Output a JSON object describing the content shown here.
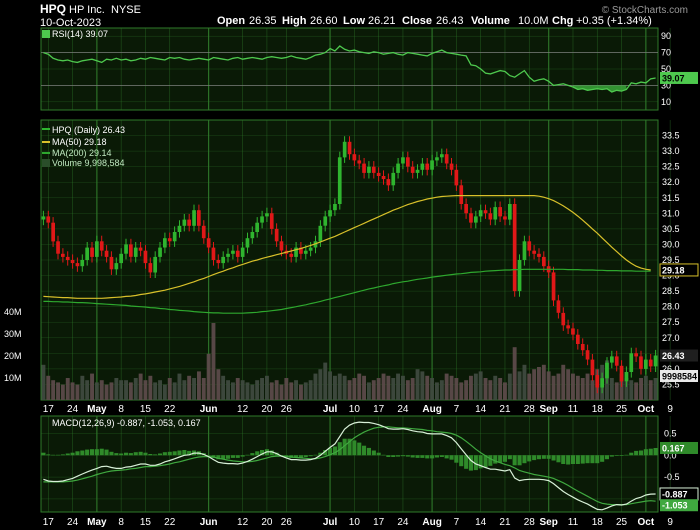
{
  "header": {
    "symbol": "HPQ",
    "company": "HP Inc.",
    "exchange": "NYSE",
    "date": "10-Oct-2023",
    "quote": {
      "open_label": "Open",
      "open": "26.35",
      "high_label": "High",
      "high": "26.60",
      "low_label": "Low",
      "low": "26.21",
      "close_label": "Close",
      "close": "26.43",
      "volume_label": "Volume",
      "volume": "10.0M",
      "chg_label": "Chg",
      "chg": "+0.35 (+1.34%)"
    },
    "watermark": "© StockCharts.com"
  },
  "colors": {
    "bg": "#000000",
    "panel": "#0a1a06",
    "grid": "#2f7a2a",
    "up": "#2fb52f",
    "down": "#e01818",
    "ma50": "#d8c02a",
    "ma200": "#2ea82e",
    "rsi": "#4ec94e",
    "macd": "#d8f0d8",
    "signal": "#3fa83f",
    "hist": "#2f8a2a",
    "volume": "#5a4f4f"
  },
  "chart_data": [
    {
      "type": "line",
      "name": "rsi",
      "legend": "RSI(14) 39.07",
      "ylim": [
        0,
        100
      ],
      "y_ticks": [
        90,
        70,
        50,
        30,
        10
      ],
      "bands": [
        30,
        70
      ],
      "last_label": "39.07",
      "values": [
        70,
        68,
        63,
        61,
        60,
        61,
        59,
        58,
        60,
        61,
        62,
        60,
        58,
        62,
        61,
        63,
        61,
        62,
        60,
        61,
        63,
        62,
        64,
        63,
        62,
        61,
        64,
        63,
        64,
        62,
        61,
        62,
        63,
        62,
        61,
        64,
        63,
        62,
        61,
        63,
        64,
        62,
        63,
        64,
        63,
        62,
        64,
        65,
        64,
        63,
        64,
        66,
        64,
        63,
        62,
        64,
        67,
        68,
        70,
        75,
        72,
        78,
        74,
        72,
        73,
        71,
        70,
        69,
        71,
        70,
        68,
        69,
        70,
        68,
        67,
        70,
        69,
        68,
        67,
        66,
        69,
        71,
        73,
        70,
        69,
        68,
        67,
        66,
        55,
        54,
        50,
        45,
        44,
        46,
        48,
        47,
        42,
        40,
        44,
        48,
        40,
        35,
        37,
        38,
        35,
        30,
        31,
        32,
        30,
        28,
        25,
        26,
        24,
        25,
        26,
        25,
        26,
        22,
        24,
        23,
        25,
        33,
        32,
        34,
        33,
        38,
        39.07
      ]
    },
    {
      "type": "candlestick",
      "name": "price",
      "legend": [
        "HPQ (Daily) 26.43",
        "MA(50) 29.18",
        "MA(200) 29.14",
        "Volume 9,998,584"
      ],
      "ylim": [
        25.0,
        34.0
      ],
      "y_ticks": [
        33.5,
        33.0,
        32.5,
        32.0,
        31.5,
        31.0,
        30.5,
        30.0,
        29.5,
        29.0,
        28.5,
        28.0,
        27.5,
        27.0,
        26.5,
        26.0,
        25.5
      ],
      "close_tag": "26.43",
      "ma_tag": "29.18",
      "volume_tag": "9998584",
      "volume_ticks": [
        "40M",
        "30M",
        "20M",
        "10M"
      ],
      "volume_ylim": [
        0,
        50
      ],
      "closes": [
        30.9,
        30.7,
        30.1,
        29.7,
        29.6,
        29.5,
        29.4,
        29.3,
        29.5,
        29.9,
        29.6,
        30.1,
        29.8,
        29.6,
        29.2,
        29.4,
        29.7,
        30.0,
        29.6,
        29.9,
        29.8,
        29.4,
        29.1,
        29.6,
        29.9,
        30.2,
        30.1,
        30.4,
        30.6,
        30.8,
        30.6,
        31.1,
        30.6,
        30.2,
        29.9,
        29.5,
        29.4,
        29.6,
        29.7,
        29.8,
        29.6,
        29.9,
        30.2,
        30.4,
        30.7,
        30.9,
        31.0,
        30.5,
        30.1,
        29.8,
        29.7,
        29.6,
        29.9,
        29.7,
        29.8,
        29.9,
        30.1,
        30.6,
        30.9,
        31.1,
        31.3,
        32.8,
        33.3,
        32.9,
        32.7,
        32.6,
        32.3,
        32.5,
        32.3,
        32.2,
        32.1,
        31.9,
        32.3,
        32.6,
        32.8,
        32.5,
        32.3,
        32.4,
        32.6,
        32.4,
        32.7,
        32.8,
        32.9,
        32.6,
        32.4,
        31.9,
        31.3,
        31.0,
        30.7,
        30.9,
        31.1,
        31.0,
        30.8,
        31.2,
        30.9,
        30.8,
        31.3,
        28.5,
        29.5,
        30.1,
        29.8,
        29.7,
        29.6,
        29.3,
        29.1,
        28.2,
        27.8,
        27.4,
        27.3,
        27.1,
        26.8,
        26.6,
        26.3,
        25.8,
        25.4,
        25.7,
        26.2,
        26.4,
        26.1,
        25.6,
        25.9,
        26.5,
        26.4,
        26.0,
        26.3,
        26.08,
        26.43
      ],
      "ma50": [
        28.33,
        28.32,
        28.31,
        28.3,
        28.29,
        28.29,
        28.28,
        28.27,
        28.27,
        28.27,
        28.27,
        28.27,
        28.27,
        28.28,
        28.29,
        28.3,
        28.31,
        28.33,
        28.34,
        28.36,
        28.39,
        28.41,
        28.44,
        28.47,
        28.5,
        28.53,
        28.57,
        28.61,
        28.65,
        28.7,
        28.75,
        28.8,
        28.86,
        28.91,
        28.97,
        29.03,
        29.09,
        29.14,
        29.2,
        29.25,
        29.31,
        29.36,
        29.41,
        29.46,
        29.5,
        29.55,
        29.59,
        29.63,
        29.67,
        29.71,
        29.75,
        29.79,
        29.83,
        29.87,
        29.92,
        29.97,
        30.02,
        30.08,
        30.14,
        30.2,
        30.26,
        30.33,
        30.4,
        30.47,
        30.54,
        30.61,
        30.68,
        30.75,
        30.82,
        30.89,
        30.96,
        31.03,
        31.1,
        31.16,
        31.22,
        31.28,
        31.33,
        31.38,
        31.42,
        31.46,
        31.49,
        31.52,
        31.54,
        31.55,
        31.56,
        31.57,
        31.57,
        31.57,
        31.57,
        31.57,
        31.57,
        31.57,
        31.57,
        31.57,
        31.57,
        31.57,
        31.57,
        31.57,
        31.57,
        31.57,
        31.57,
        31.57,
        31.55,
        31.52,
        31.47,
        31.41,
        31.33,
        31.24,
        31.14,
        31.03,
        30.91,
        30.78,
        30.64,
        30.5,
        30.36,
        30.21,
        30.06,
        29.91,
        29.77,
        29.63,
        29.5,
        29.39,
        29.3,
        29.24,
        29.2,
        29.18
      ],
      "ma200": [
        28.17,
        28.17,
        28.16,
        28.16,
        28.15,
        28.15,
        28.14,
        28.13,
        28.13,
        28.12,
        28.11,
        28.1,
        28.09,
        28.08,
        28.07,
        28.06,
        28.05,
        28.04,
        28.02,
        28.01,
        28.0,
        27.99,
        27.97,
        27.96,
        27.94,
        27.93,
        27.91,
        27.9,
        27.88,
        27.87,
        27.86,
        27.84,
        27.83,
        27.82,
        27.81,
        27.8,
        27.8,
        27.79,
        27.79,
        27.79,
        27.79,
        27.79,
        27.8,
        27.81,
        27.82,
        27.84,
        27.85,
        27.87,
        27.89,
        27.91,
        27.94,
        27.97,
        28.0,
        28.03,
        28.06,
        28.1,
        28.13,
        28.17,
        28.21,
        28.25,
        28.29,
        28.33,
        28.37,
        28.41,
        28.45,
        28.49,
        28.53,
        28.57,
        28.6,
        28.64,
        28.67,
        28.7,
        28.74,
        28.77,
        28.8,
        28.82,
        28.85,
        28.88,
        28.9,
        28.92,
        28.95,
        28.97,
        28.99,
        29.01,
        29.03,
        29.05,
        29.06,
        29.08,
        29.1,
        29.11,
        29.12,
        29.14,
        29.15,
        29.16,
        29.17,
        29.18,
        29.18,
        29.19,
        29.19,
        29.2,
        29.2,
        29.2,
        29.2,
        29.2,
        29.2,
        29.2,
        29.2,
        29.2,
        29.19,
        29.19,
        29.19,
        29.18,
        29.18,
        29.18,
        29.17,
        29.17,
        29.16,
        29.16,
        29.16,
        29.15,
        29.15,
        29.15,
        29.14,
        29.14,
        29.14,
        29.14
      ],
      "volume": [
        16,
        11,
        9,
        8,
        7,
        10,
        8,
        7,
        11,
        9,
        12,
        8,
        9,
        7,
        8,
        10,
        9,
        9,
        8,
        10,
        12,
        9,
        11,
        8,
        9,
        7,
        10,
        8,
        12,
        9,
        11,
        10,
        13,
        10,
        21,
        35,
        14,
        11,
        9,
        8,
        10,
        9,
        8,
        7,
        9,
        10,
        11,
        8,
        9,
        7,
        10,
        8,
        9,
        7,
        8,
        9,
        12,
        14,
        17,
        13,
        11,
        12,
        11,
        9,
        10,
        12,
        11,
        8,
        9,
        10,
        12,
        11,
        10,
        12,
        11,
        9,
        10,
        14,
        13,
        11,
        10,
        8,
        9,
        12,
        11,
        10,
        8,
        9,
        11,
        12,
        13,
        10,
        9,
        11,
        10,
        8,
        12,
        24,
        13,
        16,
        12,
        14,
        15,
        16,
        13,
        11,
        12,
        16,
        14,
        12,
        11,
        10,
        12,
        9,
        14,
        16,
        18,
        10,
        8,
        12,
        10,
        9,
        8,
        10,
        11,
        9,
        10
      ]
    },
    {
      "type": "line",
      "name": "macd",
      "legend": "MACD(12,26,9) -0.887, -1.053, 0.167",
      "ylim": [
        -1.3,
        0.9
      ],
      "y_ticks": [
        "0.5",
        "0.0",
        "-0.5",
        "-1.0"
      ],
      "tags": [
        "0.167",
        "-0.887",
        "-1.053"
      ],
      "macd": [
        -0.55,
        -0.59,
        -0.6,
        -0.6,
        -0.59,
        -0.56,
        -0.53,
        -0.48,
        -0.43,
        -0.38,
        -0.34,
        -0.3,
        -0.26,
        -0.25,
        -0.28,
        -0.3,
        -0.3,
        -0.27,
        -0.26,
        -0.23,
        -0.2,
        -0.2,
        -0.23,
        -0.23,
        -0.2,
        -0.15,
        -0.12,
        -0.08,
        -0.04,
        0.0,
        0.01,
        0.05,
        0.05,
        0.02,
        -0.03,
        -0.1,
        -0.16,
        -0.18,
        -0.19,
        -0.19,
        -0.2,
        -0.18,
        -0.14,
        -0.09,
        -0.03,
        0.03,
        0.08,
        0.08,
        0.04,
        -0.02,
        -0.06,
        -0.1,
        -0.1,
        -0.11,
        -0.11,
        -0.1,
        -0.07,
        0.0,
        0.09,
        0.18,
        0.26,
        0.43,
        0.6,
        0.69,
        0.74,
        0.76,
        0.75,
        0.75,
        0.73,
        0.7,
        0.66,
        0.61,
        0.6,
        0.6,
        0.61,
        0.59,
        0.56,
        0.54,
        0.53,
        0.5,
        0.49,
        0.49,
        0.49,
        0.45,
        0.4,
        0.29,
        0.15,
        0.01,
        -0.12,
        -0.2,
        -0.24,
        -0.28,
        -0.32,
        -0.32,
        -0.34,
        -0.36,
        -0.33,
        -0.52,
        -0.58,
        -0.56,
        -0.55,
        -0.55,
        -0.55,
        -0.56,
        -0.58,
        -0.65,
        -0.74,
        -0.83,
        -0.9,
        -0.96,
        -1.02,
        -1.07,
        -1.12,
        -1.18,
        -1.24,
        -1.25,
        -1.21,
        -1.16,
        -1.13,
        -1.14,
        -1.12,
        -1.05,
        -0.99,
        -0.96,
        -0.91,
        -0.89,
        -0.887
      ],
      "signal": [
        -0.61,
        -0.61,
        -0.61,
        -0.61,
        -0.61,
        -0.6,
        -0.59,
        -0.57,
        -0.54,
        -0.51,
        -0.48,
        -0.44,
        -0.41,
        -0.38,
        -0.36,
        -0.35,
        -0.34,
        -0.33,
        -0.31,
        -0.3,
        -0.28,
        -0.26,
        -0.26,
        -0.25,
        -0.24,
        -0.22,
        -0.2,
        -0.17,
        -0.15,
        -0.12,
        -0.09,
        -0.06,
        -0.04,
        -0.03,
        -0.03,
        -0.04,
        -0.07,
        -0.09,
        -0.11,
        -0.13,
        -0.14,
        -0.15,
        -0.15,
        -0.14,
        -0.12,
        -0.09,
        -0.06,
        -0.03,
        -0.02,
        -0.02,
        -0.03,
        -0.04,
        -0.05,
        -0.06,
        -0.07,
        -0.08,
        -0.08,
        -0.06,
        -0.03,
        0.01,
        0.06,
        0.13,
        0.22,
        0.31,
        0.4,
        0.47,
        0.53,
        0.58,
        0.62,
        0.64,
        0.65,
        0.65,
        0.64,
        0.63,
        0.63,
        0.62,
        0.61,
        0.6,
        0.59,
        0.57,
        0.56,
        0.54,
        0.53,
        0.52,
        0.5,
        0.46,
        0.4,
        0.32,
        0.23,
        0.14,
        0.06,
        -0.01,
        -0.08,
        -0.13,
        -0.17,
        -0.21,
        -0.24,
        -0.29,
        -0.35,
        -0.38,
        -0.41,
        -0.44,
        -0.46,
        -0.48,
        -0.5,
        -0.53,
        -0.58,
        -0.63,
        -0.69,
        -0.76,
        -0.82,
        -0.88,
        -0.94,
        -1.0,
        -1.06,
        -1.1,
        -1.12,
        -1.13,
        -1.13,
        -1.13,
        -1.13,
        -1.11,
        -1.09,
        -1.07,
        -1.05,
        -1.04,
        -1.053
      ]
    }
  ],
  "x_axis": {
    "labels": [
      {
        "text": "17",
        "bold": false,
        "i": 1
      },
      {
        "text": "24",
        "bold": false,
        "i": 6
      },
      {
        "text": "May",
        "bold": true,
        "i": 11
      },
      {
        "text": "8",
        "bold": false,
        "i": 16
      },
      {
        "text": "15",
        "bold": false,
        "i": 21
      },
      {
        "text": "22",
        "bold": false,
        "i": 26
      },
      {
        "text": "Jun",
        "bold": true,
        "i": 34
      },
      {
        "text": "12",
        "bold": false,
        "i": 41
      },
      {
        "text": "20",
        "bold": false,
        "i": 46
      },
      {
        "text": "26",
        "bold": false,
        "i": 50
      },
      {
        "text": "Jul",
        "bold": true,
        "i": 59
      },
      {
        "text": "10",
        "bold": false,
        "i": 64
      },
      {
        "text": "17",
        "bold": false,
        "i": 69
      },
      {
        "text": "24",
        "bold": false,
        "i": 74
      },
      {
        "text": "Aug",
        "bold": true,
        "i": 80
      },
      {
        "text": "7",
        "bold": false,
        "i": 85
      },
      {
        "text": "14",
        "bold": false,
        "i": 90
      },
      {
        "text": "21",
        "bold": false,
        "i": 95
      },
      {
        "text": "28",
        "bold": false,
        "i": 100
      },
      {
        "text": "Sep",
        "bold": true,
        "i": 104
      },
      {
        "text": "11",
        "bold": false,
        "i": 109
      },
      {
        "text": "18",
        "bold": false,
        "i": 114
      },
      {
        "text": "25",
        "bold": false,
        "i": 119
      },
      {
        "text": "Oct",
        "bold": true,
        "i": 124
      },
      {
        "text": "9",
        "bold": false,
        "i": 129
      }
    ]
  }
}
